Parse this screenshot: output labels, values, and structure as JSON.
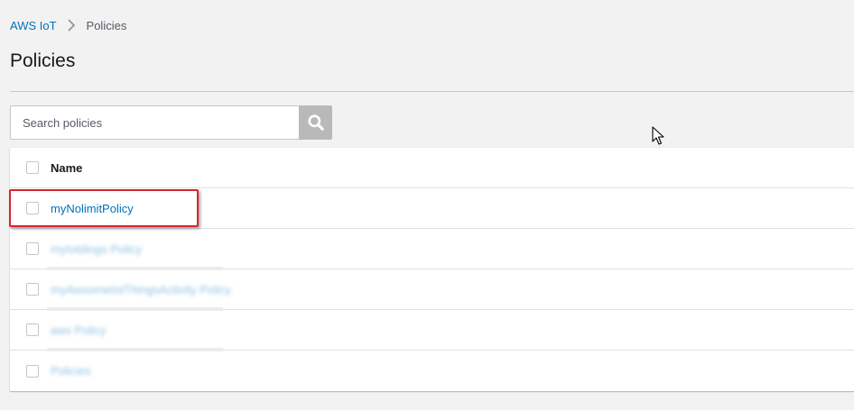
{
  "breadcrumb": {
    "root": "AWS IoT",
    "current": "Policies"
  },
  "page": {
    "title": "Policies"
  },
  "search": {
    "placeholder": "Search policies",
    "value": ""
  },
  "table": {
    "header": "Name",
    "rows": [
      {
        "name": "myNolimitPolicy",
        "redacted": false,
        "highlighted": true
      },
      {
        "name": "myIotdings Policy",
        "redacted": true,
        "highlighted": false
      },
      {
        "name": "myAwsomeIotThingsActivity Policy",
        "redacted": true,
        "highlighted": false
      },
      {
        "name": "aws Policy",
        "redacted": true,
        "highlighted": false
      },
      {
        "name": "Policies",
        "redacted": true,
        "highlighted": false
      }
    ]
  },
  "colors": {
    "link": "#0073bb",
    "highlight": "#d9232e",
    "background": "#f2f2f2",
    "search_button": "#b9b9b9"
  },
  "icons": {
    "breadcrumb_separator": "chevron-right-icon",
    "search_button": "search-icon",
    "cursor": "mouse-pointer-icon"
  }
}
